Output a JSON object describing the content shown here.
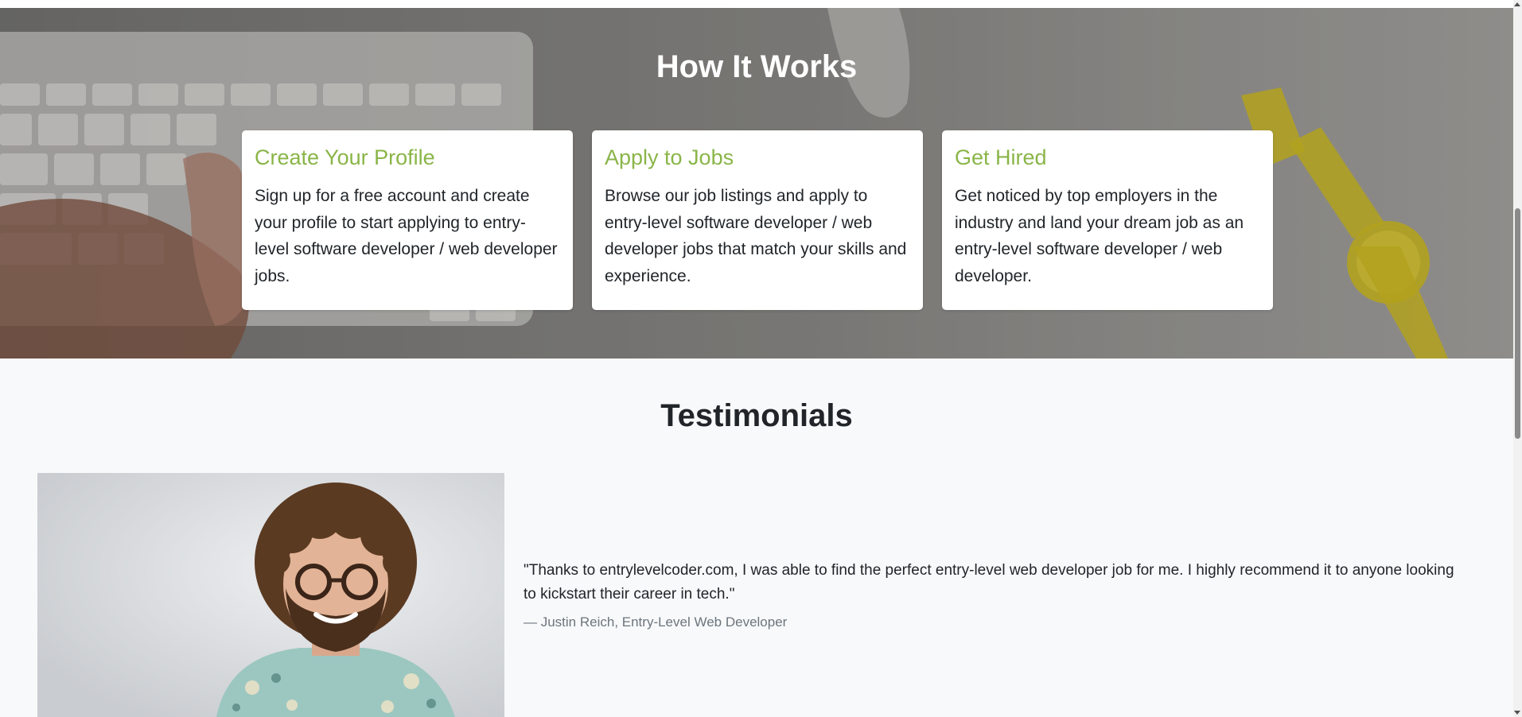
{
  "how_it_works": {
    "title": "How It Works",
    "steps": [
      {
        "title": "Create Your Profile",
        "text": "Sign up for a free account and create your profile to start applying to entry-level software developer / web developer jobs."
      },
      {
        "title": "Apply to Jobs",
        "text": "Browse our job listings and apply to entry-level software developer / web developer jobs that match your skills and experience."
      },
      {
        "title": "Get Hired",
        "text": "Get noticed by top employers in the industry and land your dream job as an entry-level software developer / web developer."
      }
    ],
    "colors": {
      "step_title": "#8ab548",
      "heading": "#ffffff"
    }
  },
  "testimonials": {
    "title": "Testimonials",
    "items": [
      {
        "quote": "\"Thanks to entrylevelcoder.com, I was able to find the perfect entry-level web developer job for me. I highly recommend it to anyone looking to kickstart their career in tech.\"",
        "author": "— Justin Reich, Entry-Level Web Developer"
      }
    ]
  }
}
